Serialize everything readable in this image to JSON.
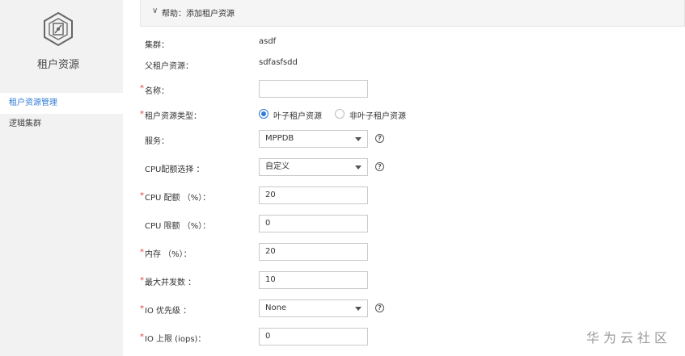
{
  "sidebar": {
    "title": "租户资源",
    "items": [
      {
        "label": "租户资源管理",
        "active": true
      },
      {
        "label": "逻辑集群",
        "active": false
      }
    ]
  },
  "help": {
    "chevron": "∨",
    "label": "帮助：添加租户资源"
  },
  "form": {
    "cluster": {
      "label": "集群：",
      "value": "asdf"
    },
    "parent": {
      "label": "父租户资源：",
      "value": "sdfasfsdd"
    },
    "name": {
      "label": "名称：",
      "value": ""
    },
    "type": {
      "label": "租户资源类型：",
      "options": [
        "叶子租户资源",
        "非叶子租户资源"
      ],
      "selected": "叶子租户资源"
    },
    "service": {
      "label": "服务：",
      "value": "MPPDB"
    },
    "cpu_select": {
      "label": "CPU配额选择 ：",
      "value": "自定义"
    },
    "cpu_quota": {
      "label": "CPU 配额 （%）：",
      "value": "20"
    },
    "cpu_limit": {
      "label": "CPU 限额 （%）：",
      "value": "0"
    },
    "memory": {
      "label": "内存 （%）：",
      "value": "20"
    },
    "max_concurrency": {
      "label": "最大并发数 ：",
      "value": "10"
    },
    "io_priority": {
      "label": "IO 优先级 ：",
      "value": "None"
    },
    "io_limit": {
      "label": "IO 上限 (iops)：",
      "value": "0"
    }
  },
  "help_icon_symbol": "?",
  "required_mark": "*",
  "watermark": "华为云社区",
  "colors": {
    "accent": "#2f7bd6",
    "required": "#e0403f",
    "sidebar_bg": "#f2f2f3"
  }
}
